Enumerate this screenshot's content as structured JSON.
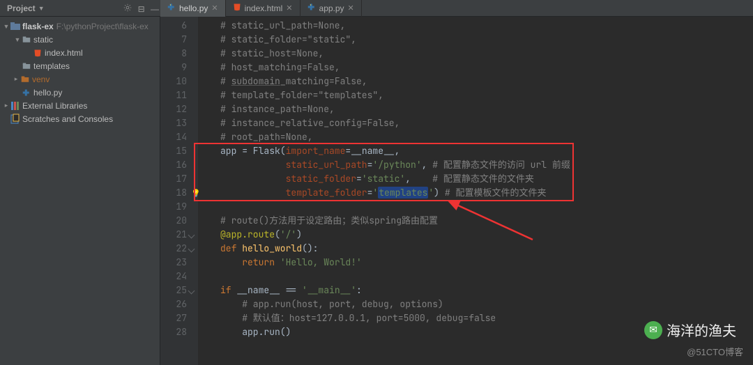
{
  "toolwindow_title": "Project",
  "project_root": {
    "name": "flask-ex",
    "hint": "F:\\pythonProject\\flask-ex"
  },
  "tree": {
    "static": "static",
    "index_html": "index.html",
    "templates": "templates",
    "venv": "venv",
    "hello_py": "hello.py",
    "ext_libs": "External Libraries",
    "scratches": "Scratches and Consoles"
  },
  "tabs": [
    {
      "label": "hello.py",
      "icon": "py",
      "active": true
    },
    {
      "label": "index.html",
      "icon": "html",
      "active": false
    },
    {
      "label": "app.py",
      "icon": "py",
      "active": false
    }
  ],
  "gutter_start": 6,
  "lines": [
    {
      "t": "cmt",
      "raw": "# static_url_path=None,"
    },
    {
      "t": "cmt",
      "raw": "# static_folder=\"static\","
    },
    {
      "t": "cmt",
      "raw": "# static_host=None,"
    },
    {
      "t": "cmt",
      "raw": "# host_matching=False,"
    },
    {
      "t": "subdomain"
    },
    {
      "t": "cmt",
      "raw": "# template_folder=\"templates\","
    },
    {
      "t": "cmt",
      "raw": "# instance_path=None,"
    },
    {
      "t": "cmt",
      "raw": "# instance_relative_config=False,"
    },
    {
      "t": "cmt",
      "raw": "# root_path=None,"
    },
    {
      "t": "l15"
    },
    {
      "t": "l16"
    },
    {
      "t": "l17"
    },
    {
      "t": "l18"
    },
    {
      "t": "blank"
    },
    {
      "t": "cmt",
      "raw": "# route()方法用于设定路由；类似spring路由配置"
    },
    {
      "t": "l21"
    },
    {
      "t": "l22"
    },
    {
      "t": "l23"
    },
    {
      "t": "blank"
    },
    {
      "t": "l25"
    },
    {
      "t": "cmt2",
      "raw": "# app.run(host, port, debug, options)"
    },
    {
      "t": "cmt2",
      "raw": "# 默认值：host=127.0.0.1, port=5000, debug=false"
    },
    {
      "t": "l28"
    }
  ],
  "strings": {
    "subdomain_pre": "# ",
    "subdomain_u": "subdomain",
    "subdomain_post": "_matching=False,",
    "l15_a": "app = Flask(",
    "l15_b": "import_name",
    "l15_c": "=__name__,",
    "l16_a": "            ",
    "l16_b": "static_url_path",
    "l16_c": "=",
    "l16_d": "'/python'",
    "l16_e": ", ",
    "l16_f": "# 配置静态文件的访问 url 前缀",
    "l17_a": "            ",
    "l17_b": "static_folder",
    "l17_c": "=",
    "l17_d": "'static'",
    "l17_e": ",    ",
    "l17_f": "# 配置静态文件的文件夹",
    "l18_a": "            ",
    "l18_b": "template_folder",
    "l18_c": "=",
    "l18_d1": "'",
    "l18_sel": "templates",
    "l18_d2": "'",
    "l18_e": ") ",
    "l18_f": "# 配置模板文件的文件夹",
    "l21": "@app.route",
    "l21b": "(",
    "l21c": "'/'",
    "l21d": ")",
    "l22a": "def ",
    "l22b": "hello_world",
    "l22c": "():",
    "l23a": "    ",
    "l23b": "return ",
    "l23c": "'Hello, World!'",
    "l25a": "if ",
    "l25b": "__name__ == ",
    "l25c": "'__main__'",
    "l25d": ":",
    "l28a": "    app.run()"
  },
  "watermarks": {
    "signature": "海洋的渔夫",
    "site": "@51CTO博客"
  }
}
